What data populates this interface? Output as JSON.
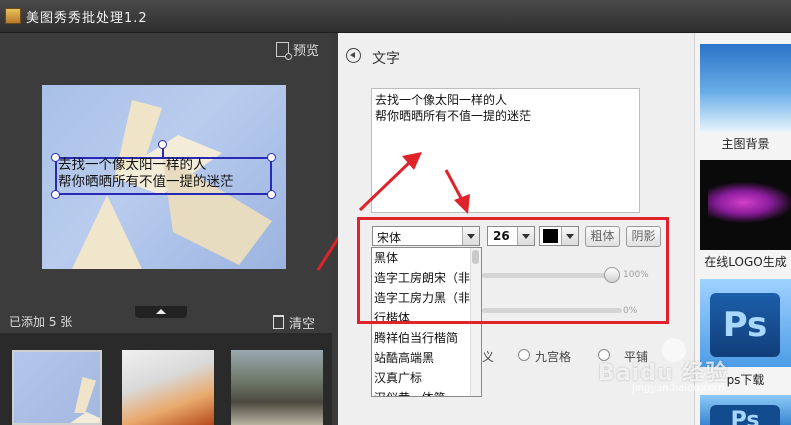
{
  "app": {
    "title": "美图秀秀批处理1.2"
  },
  "left_panel": {
    "preview_label": "预览",
    "canvas_text": [
      "去找一个像太阳一样的人",
      "帮你晒晒所有不值一提的迷茫"
    ],
    "added_count": "已添加 5 张",
    "clear_label": "清空"
  },
  "text_panel": {
    "title": "文字",
    "content": "去找一个像太阳一样的人\n帮你晒晒所有不值一提的迷茫",
    "font": "宋体",
    "size": "26",
    "color": "#000000",
    "bold_label": "粗体",
    "shadow_label": "阴影",
    "font_options": [
      "黑体",
      "造字工房朗宋（非",
      "造字工房力黑（非",
      "行楷体",
      "腾祥伯当行楷简",
      "站酷高端黑",
      "汉真广标",
      "汉仪黄...体简"
    ],
    "slider1_value": "100%",
    "slider2_value": "0%",
    "option_partial": "义",
    "radio_grid_label": "九宫格",
    "radio_tile_label": "平铺"
  },
  "templates": [
    {
      "label": "主图背景"
    },
    {
      "label": "在线LOGO生成"
    },
    {
      "label": "ps下载",
      "logo": "Ps"
    },
    {
      "logo": "Ps"
    }
  ],
  "watermark": {
    "main": "Baidu 经验",
    "sub": "jingyan.baidu.com"
  },
  "accent_colors": {
    "highlight": "#e0232b",
    "handle": "#2a2ab8"
  }
}
